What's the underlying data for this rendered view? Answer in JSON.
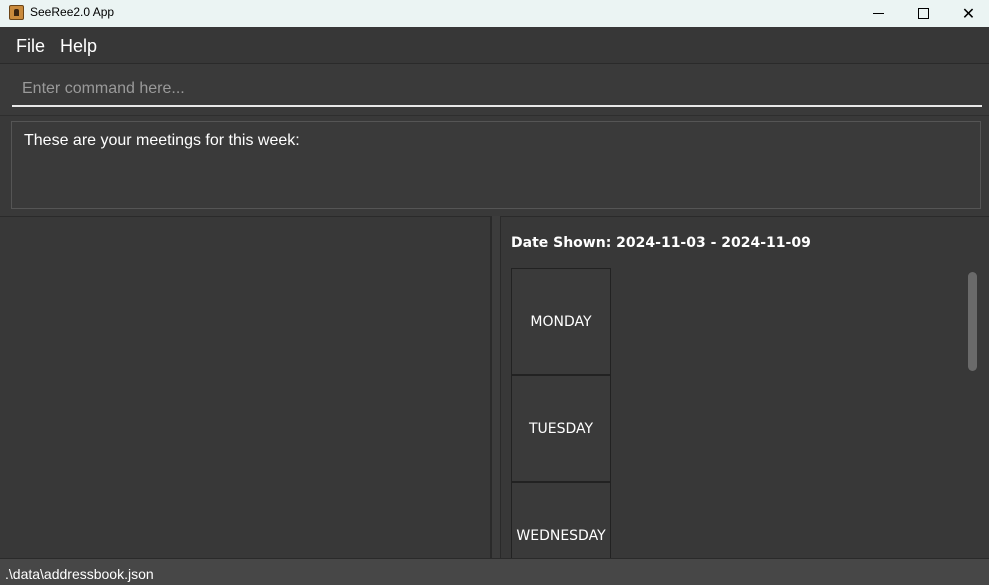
{
  "window": {
    "title": "SeeRee2.0 App",
    "close_glyph": "✕"
  },
  "menu": {
    "items": [
      {
        "label": "File"
      },
      {
        "label": "Help"
      }
    ]
  },
  "command": {
    "placeholder": "Enter command here...",
    "value": ""
  },
  "result": {
    "text": "These are your meetings for this week:"
  },
  "schedule": {
    "date_shown": "Date Shown: 2024-11-03 - 2024-11-09",
    "days": [
      {
        "label": "MONDAY"
      },
      {
        "label": "TUESDAY"
      },
      {
        "label": "WEDNESDAY"
      }
    ]
  },
  "status": {
    "file_path": ".\\data\\addressbook.json"
  },
  "icons": {
    "app": "app-icon",
    "minimize": "minimize-icon",
    "maximize": "maximize-icon",
    "close": "close-icon"
  },
  "colors": {
    "background": "#383838",
    "titlebar": "#ebf4f3",
    "status_bar": "#474747",
    "text": "#ffffff"
  }
}
